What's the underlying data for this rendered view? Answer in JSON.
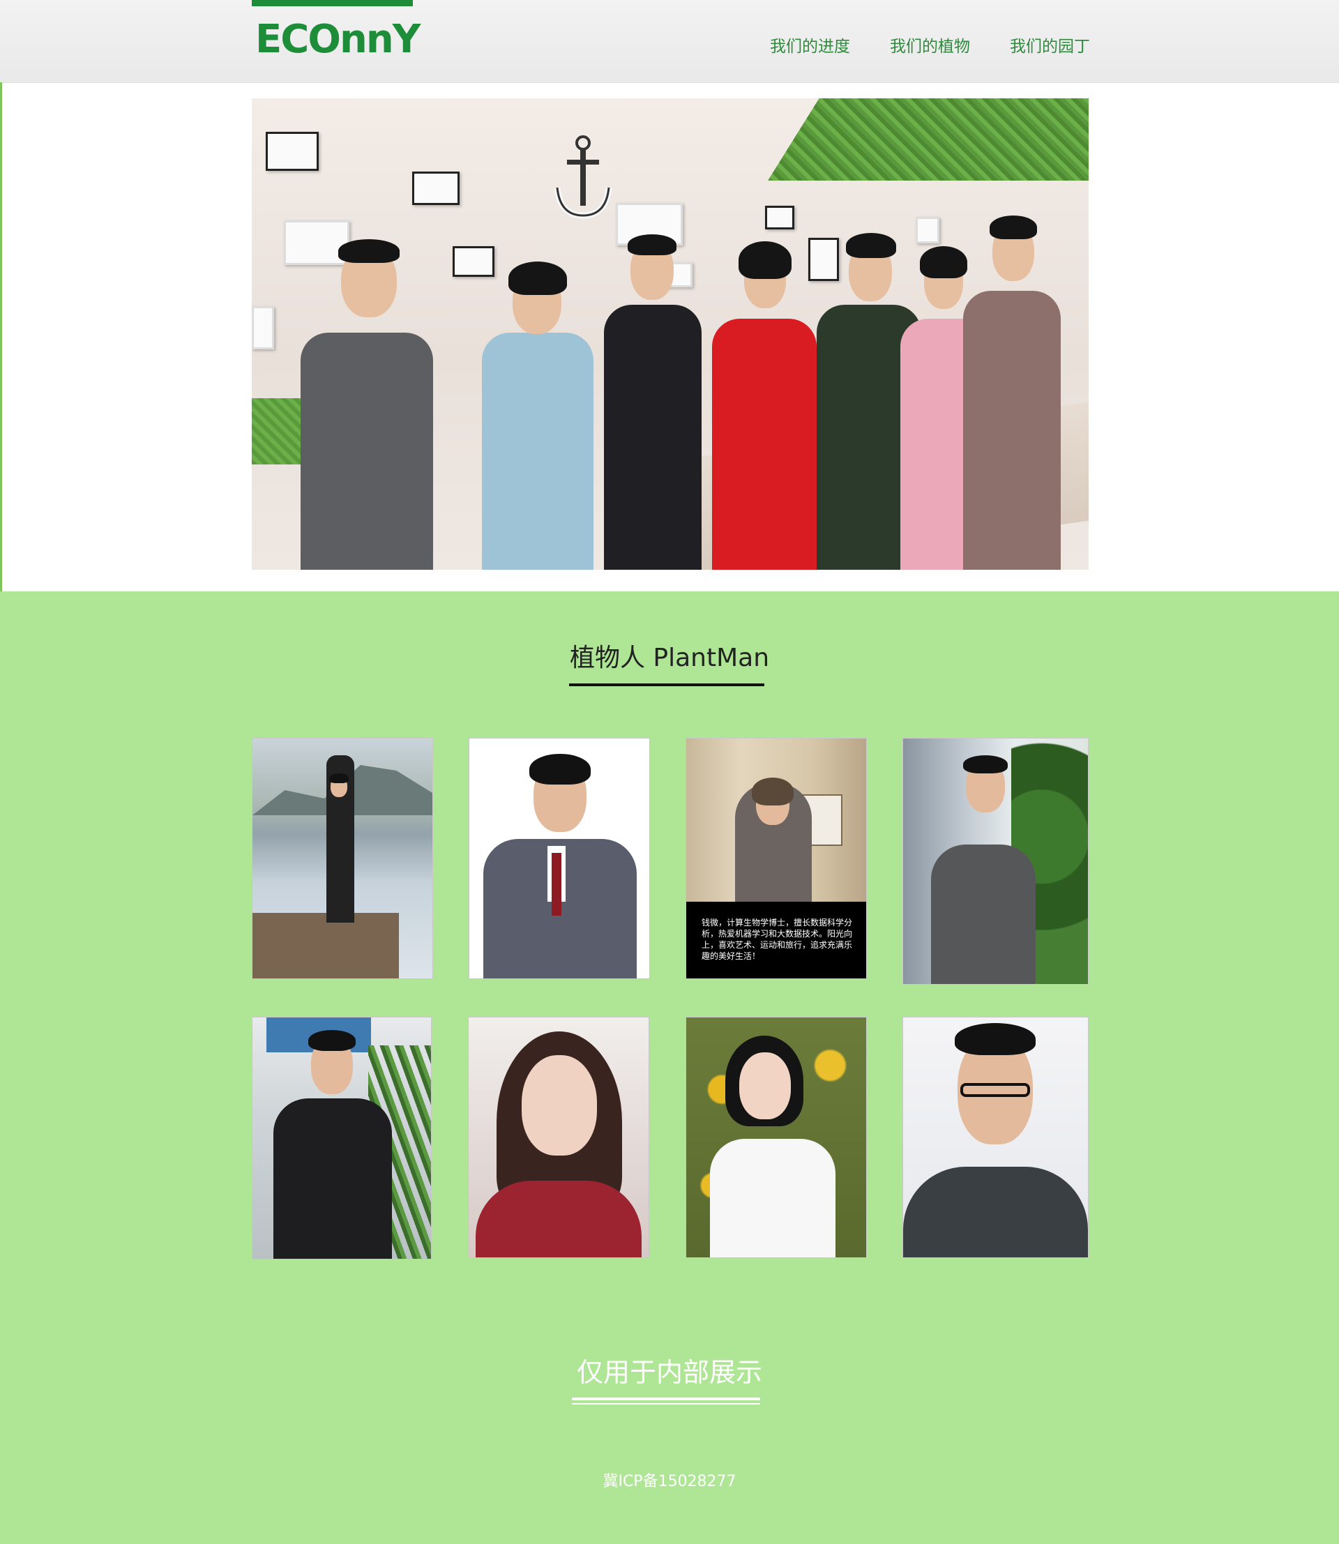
{
  "header": {
    "logo_text": "ECOnnY",
    "brand_color": "#1e8d3a",
    "nav": [
      {
        "label": "我们的进度"
      },
      {
        "label": "我们的植物"
      },
      {
        "label": "我们的园丁"
      }
    ]
  },
  "hero": {
    "image_name": "team-group-photo"
  },
  "plantman": {
    "title": "植物人 PlantMan",
    "background_color": "#afe695",
    "members": [
      {
        "photo": "member-lake-photo"
      },
      {
        "photo": "member-suit-photo"
      },
      {
        "photo": "member-room-photo",
        "caption": "钱微，计算生物学博士，擅长数据科学分析，热爱机器学习和大数据技术。阳光向上，喜欢艺术、运动和旅行，追求充满乐趣的美好生活！"
      },
      {
        "photo": "member-office-window-photo"
      },
      {
        "photo": "member-office-plant-photo"
      },
      {
        "photo": "member-selfie-red-photo"
      },
      {
        "photo": "member-flowers-photo"
      },
      {
        "photo": "member-selfie-glasses-photo"
      }
    ]
  },
  "footer": {
    "note": "仅用于内部展示",
    "icp": "冀ICP备15028277"
  }
}
